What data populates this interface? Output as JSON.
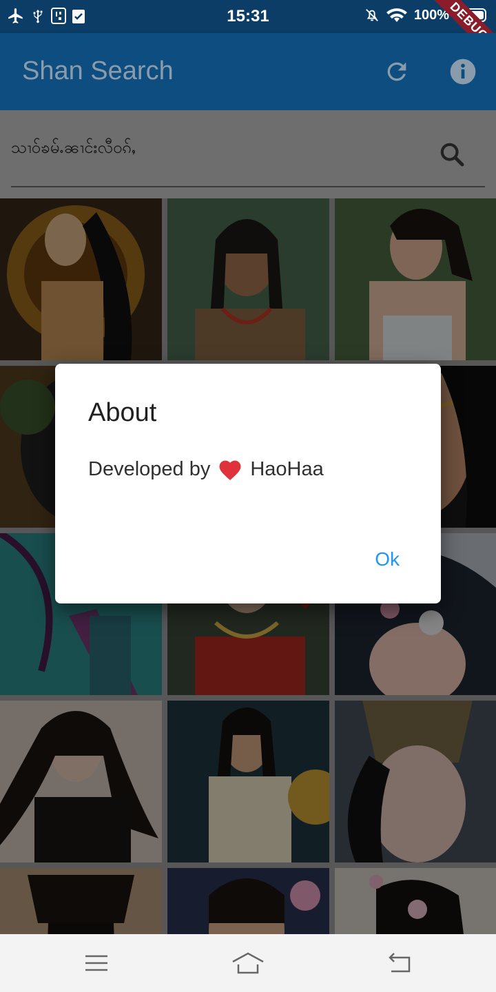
{
  "status": {
    "time": "15:31",
    "battery": "100%",
    "debug_label": "DEBUG"
  },
  "appbar": {
    "title": "Shan Search",
    "icons": [
      "refresh-icon",
      "info-icon"
    ]
  },
  "search": {
    "value": "သၢဝ်ၶမ်ႉၼၢင်းလီဝၵ်ႇ"
  },
  "dialog": {
    "title": "About",
    "content_prefix": "Developed by",
    "content_suffix": "HaoHaa",
    "ok_label": "Ok"
  },
  "grid": {
    "columns": 3,
    "image_count": 15
  },
  "colors": {
    "appbar": "#1976d2",
    "accent": "#2196f3",
    "debug": "#b71c1c"
  }
}
